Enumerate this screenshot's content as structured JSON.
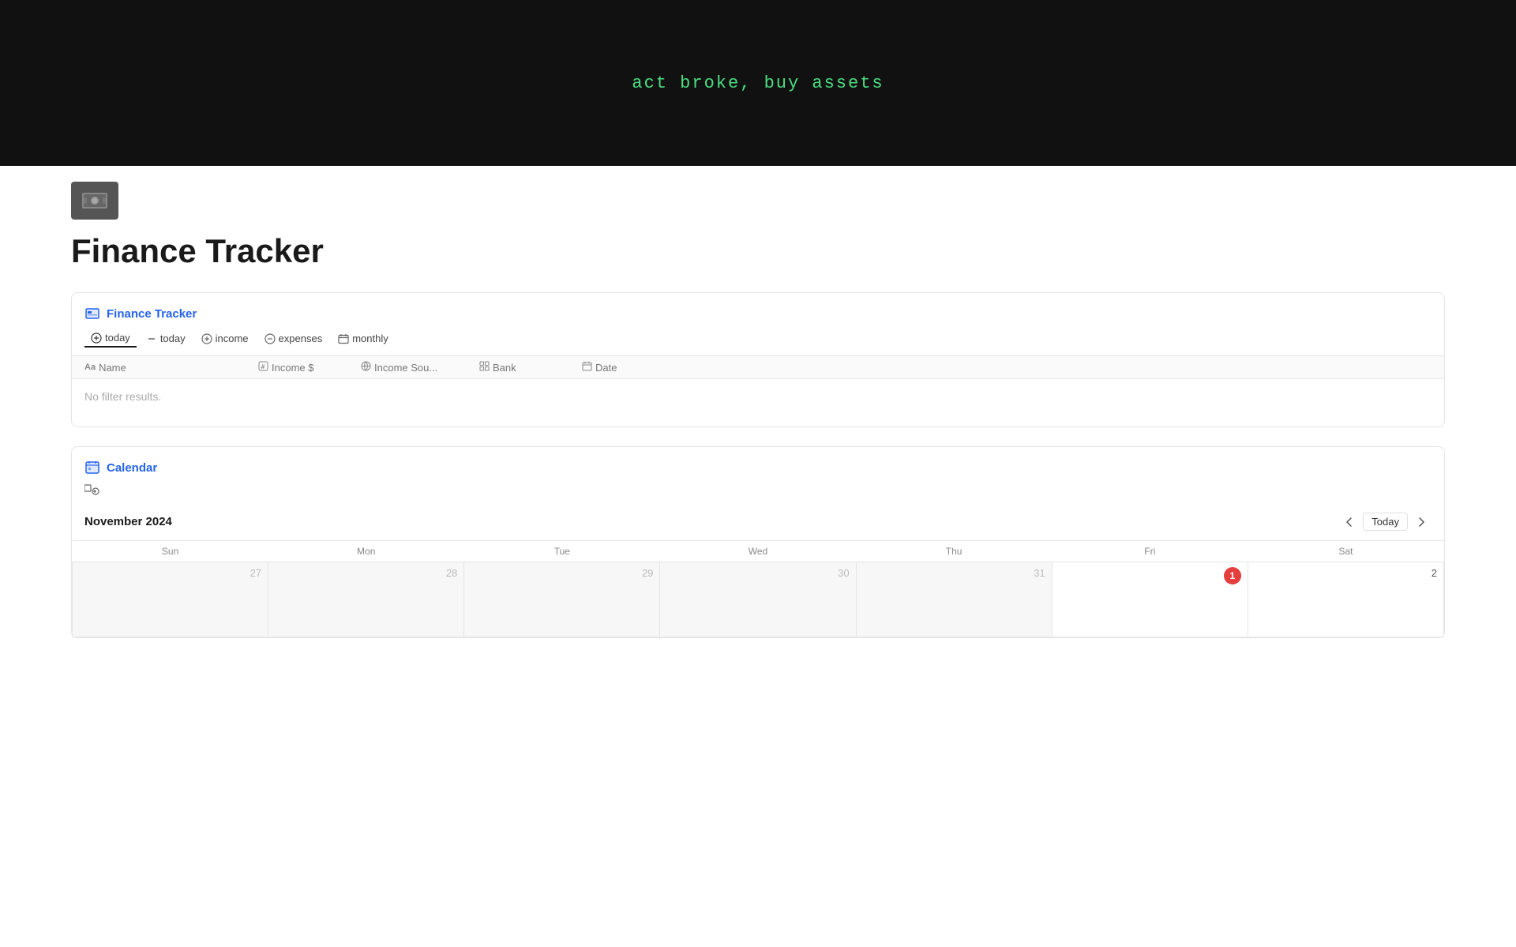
{
  "hero": {
    "tagline": "act broke, buy assets"
  },
  "page": {
    "title": "Finance Tracker",
    "icon_label": "money-icon"
  },
  "finance_tracker_db": {
    "title": "Finance Tracker",
    "filters": [
      {
        "id": "add-today",
        "label": "today",
        "type": "add",
        "active": true
      },
      {
        "id": "filter-today",
        "label": "today",
        "type": "dash"
      },
      {
        "id": "filter-income",
        "label": "income",
        "type": "plus-circle"
      },
      {
        "id": "filter-expenses",
        "label": "expenses",
        "type": "minus-circle"
      },
      {
        "id": "filter-monthly",
        "label": "monthly",
        "type": "calendar"
      }
    ],
    "columns": [
      {
        "id": "col-name",
        "label": "Name",
        "icon": "text-icon"
      },
      {
        "id": "col-income",
        "label": "Income $",
        "icon": "number-icon"
      },
      {
        "id": "col-source",
        "label": "Income Sou...",
        "icon": "number-icon"
      },
      {
        "id": "col-bank",
        "label": "Bank",
        "icon": "grid-icon"
      },
      {
        "id": "col-date",
        "label": "Date",
        "icon": "calendar-icon"
      }
    ],
    "empty_message": "No filter results."
  },
  "calendar_db": {
    "title": "Calendar",
    "month_label": "November 2024",
    "today_btn": "Today",
    "days_of_week": [
      "Sun",
      "Mon",
      "Tue",
      "Wed",
      "Thu",
      "Fri",
      "Sat"
    ],
    "weeks": [
      [
        {
          "day": 27,
          "type": "outside"
        },
        {
          "day": 28,
          "type": "outside"
        },
        {
          "day": 29,
          "type": "outside"
        },
        {
          "day": 30,
          "type": "outside"
        },
        {
          "day": 31,
          "type": "outside"
        },
        {
          "day": 1,
          "type": "today"
        },
        {
          "day": 2,
          "type": "current"
        }
      ]
    ]
  }
}
